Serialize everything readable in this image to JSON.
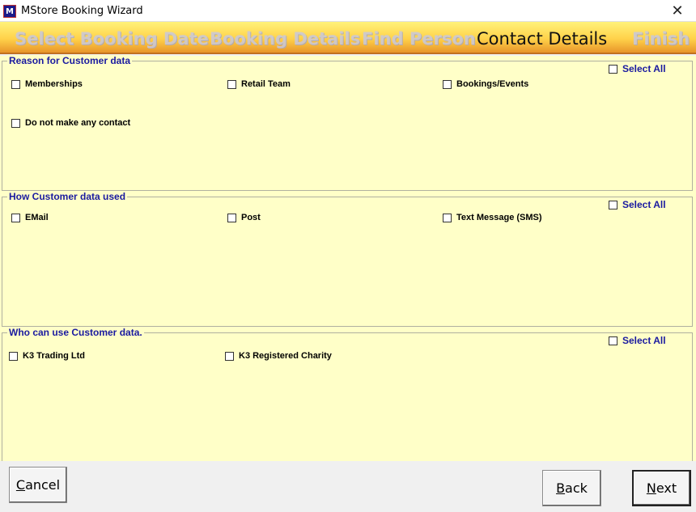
{
  "window": {
    "icon_text": "M",
    "title": "MStore Booking Wizard",
    "close_glyph": "✕"
  },
  "steps": [
    {
      "label": "Select Booking Date",
      "active": false
    },
    {
      "label": "Booking Details",
      "active": false
    },
    {
      "label": "Find Person",
      "active": false
    },
    {
      "label": "Contact Details",
      "active": true
    },
    {
      "label": "Finish",
      "active": false
    }
  ],
  "groups": {
    "reason": {
      "title": "Reason for Customer data",
      "select_all": "Select All",
      "options": [
        "Memberships",
        "Retail Team",
        "Bookings/Events",
        "Do not make any contact"
      ]
    },
    "usage": {
      "title": "How Customer data used",
      "select_all": "Select All",
      "options": [
        "EMail",
        "Post",
        "Text Message (SMS)"
      ]
    },
    "who": {
      "title": "Who can use Customer data.",
      "select_all": "Select All",
      "options": [
        "K3 Trading Ltd",
        "K3 Registered Charity"
      ]
    }
  },
  "buttons": {
    "cancel": {
      "first": "C",
      "rest": "ancel"
    },
    "back": {
      "first": "B",
      "rest": "ack"
    },
    "next": {
      "first": "N",
      "rest": "ext"
    }
  },
  "colors": {
    "panel_bg": "#ffffc8",
    "title_blue": "#1a1aa0",
    "banner_top": "#fff27a",
    "banner_bottom": "#e8952a"
  }
}
